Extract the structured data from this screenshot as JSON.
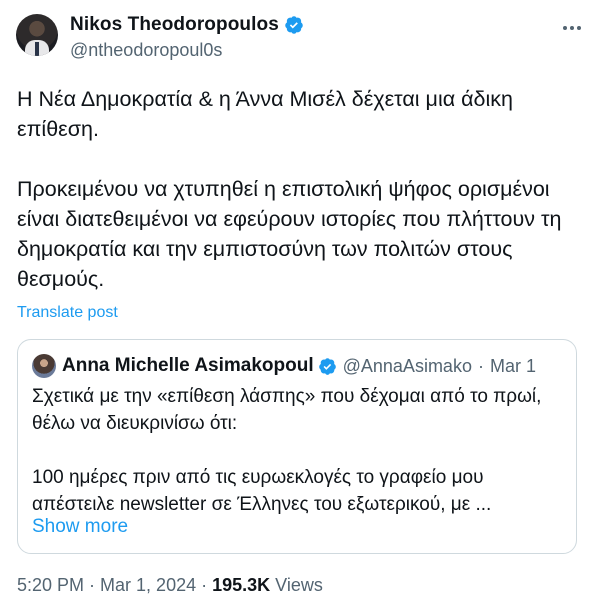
{
  "author": {
    "display_name": "Nikos Theodoropoulos",
    "handle": "@ntheodoropoul0s",
    "verified_color": "#1d9bf0"
  },
  "tweet": {
    "text": "Η Νέα Δημοκρατία & η Άννα Μισέλ δέχεται μια άδικη επίθεση.\n\nΠροκειμένου να χτυπηθεί η επιστολική ψήφος ορισμένοι είναι διατεθειμένοι να εφεύρουν ιστορίες που πλήττουν τη δημοκρατία και την εμπιστοσύνη των πολιτών στους θεσμούς.",
    "translate_label": "Translate post"
  },
  "quote": {
    "display_name": "Anna Michelle Asimakopoul",
    "handle": "@AnnaAsimako",
    "dot": "·",
    "date": "Mar 1",
    "text": "Σχετικά με την «επίθεση λάσπης» που δέχομαι από το πρωί, θέλω να διευκρινίσω ότι:\n\n100 ημέρες πριν από τις ευρωεκλογές το γραφείο μου απέστειλε newsletter σε Έλληνες του εξωτερικού, με ...",
    "show_more_label": "Show more"
  },
  "meta": {
    "time": "5:20 PM",
    "sep1": "·",
    "date": "Mar 1, 2024",
    "sep2": "·",
    "views_count": "195.3K",
    "views_label": "Views"
  },
  "icons": {
    "more": "more-horizontal-icon",
    "verified": "verified-badge-icon"
  },
  "colors": {
    "accent": "#1d9bf0",
    "secondary_text": "#536471",
    "primary_text": "#0f1419",
    "border": "#cfd9de"
  }
}
